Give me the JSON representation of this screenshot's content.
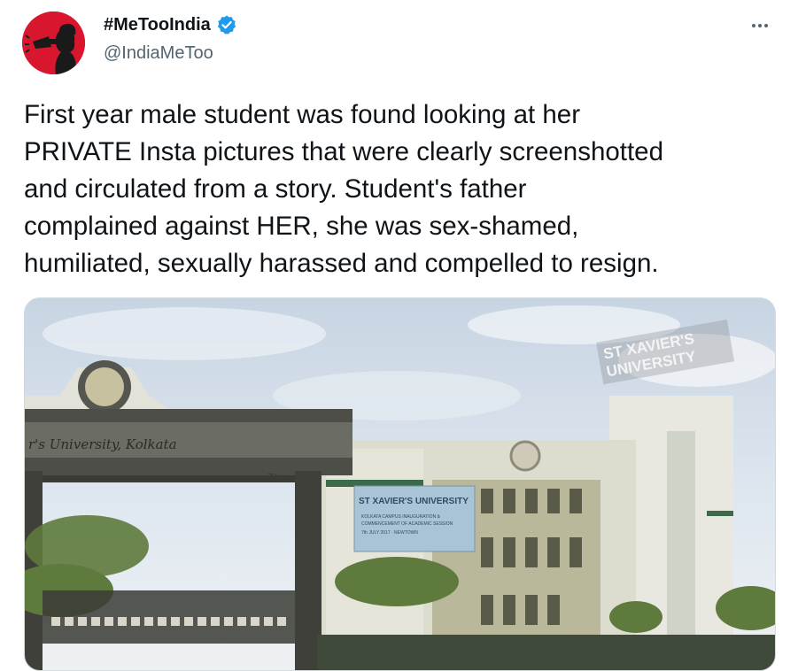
{
  "account": {
    "display_name": "#MeTooIndia",
    "handle": "@IndiaMeToo",
    "verified": true,
    "verified_color": "#1d9bf0",
    "avatar_color": "#d8172f"
  },
  "menu": {
    "icon": "more-horizontal-icon"
  },
  "tweet": {
    "text": "First year male student was found looking at her\nPRIVATE Insta pictures that were clearly screenshotted\nand circulated from a story. Student's father\ncomplained against HER, she was sex-shamed,\nhumiliated, sexually harassed and compelled to resign."
  },
  "media": {
    "rooftop_sign_line1": "ST XAVIER'S",
    "rooftop_sign_line2": "UNIVERSITY",
    "gate_inscription": "r's University, Kolkata",
    "gate_small_text": "ক১৪",
    "banner_title": "ST XAVIER'S UNIVERSITY",
    "banner_line1": "KOLKATA CAMPUS INAUGURATION &",
    "banner_line2": "COMMENCEMENT OF ACADEMIC SESSION",
    "banner_line3": "7th JULY 2017 · NEWTOWN"
  }
}
